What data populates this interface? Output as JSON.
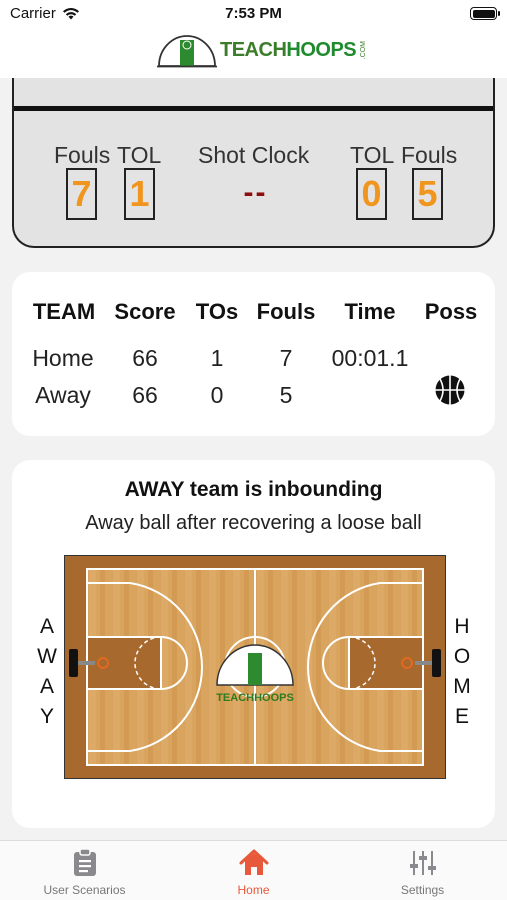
{
  "status_bar": {
    "carrier": "Carrier",
    "time": "7:53 PM"
  },
  "header": {
    "logo_teach": "TEACH",
    "logo_hoops": "HOOPS",
    "logo_com": ".COM"
  },
  "scoreboard": {
    "left_fouls_label": "Fouls",
    "left_tol_label": "TOL",
    "shot_clock_label": "Shot Clock",
    "right_tol_label": "TOL",
    "right_fouls_label": "Fouls",
    "left_fouls": "7",
    "left_tol": "1",
    "shot_clock": "--",
    "right_tol": "0",
    "right_fouls": "5",
    "digit_color": "#f0961e",
    "shot_clock_color": "#8b0f0f"
  },
  "stats": {
    "headers": [
      "TEAM",
      "Score",
      "TOs",
      "Fouls",
      "Time",
      "Poss"
    ],
    "rows": [
      {
        "team": "Home",
        "score": "66",
        "tos": "1",
        "fouls": "7",
        "time": "00:01.1",
        "poss": ""
      },
      {
        "team": "Away",
        "score": "66",
        "tos": "0",
        "fouls": "5",
        "time": "",
        "poss": "basketball-icon"
      }
    ]
  },
  "court_card": {
    "title": "AWAY team is inbounding",
    "subtitle": "Away ball after recovering a loose ball",
    "left_side_label": [
      "A",
      "W",
      "A",
      "Y"
    ],
    "right_side_label": [
      "H",
      "O",
      "M",
      "E"
    ],
    "center_logo_text": "TEACHHOOPS"
  },
  "tabbar": {
    "tabs": [
      {
        "label": "User Scenarios",
        "icon": "clipboard-icon"
      },
      {
        "label": "Home",
        "icon": "home-icon",
        "active": true
      },
      {
        "label": "Settings",
        "icon": "sliders-icon"
      }
    ],
    "active_color": "#e8583a"
  }
}
